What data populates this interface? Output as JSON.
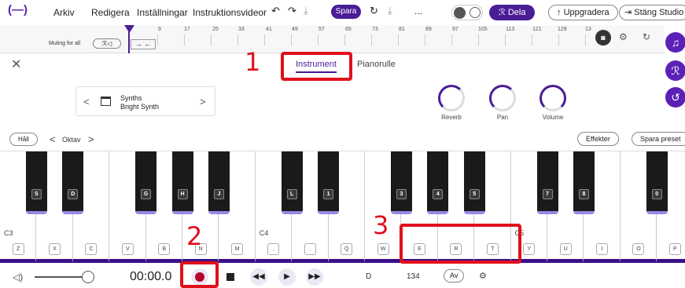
{
  "topbar": {
    "logo": "(—)",
    "menu": [
      "Arkiv",
      "Redigera",
      "Inställningar",
      "Instruktionsvideor"
    ],
    "undo_icon": "↶",
    "redo_icon": "↷",
    "download_icon": "⤓",
    "save_label": "Spara",
    "sync_icon": "↻",
    "upload_icon": "⤓",
    "more": "...",
    "share_label": "Dela",
    "upgrade_label": "Uppgradera",
    "close_studio_label": "Stäng Studio"
  },
  "timeline": {
    "muting_label": "Muting for all",
    "ticks": [
      "9",
      "17",
      "25",
      "33",
      "41",
      "49",
      "57",
      "65",
      "73",
      "81",
      "89",
      "97",
      "105",
      "113",
      "121",
      "129",
      "13"
    ]
  },
  "instrument_panel": {
    "close": "✕",
    "tab_instrument": "Instrument",
    "tab_piano_roll": "Pianorulle",
    "category": "Synths",
    "preset": "Bright Synth",
    "prev": "<",
    "next": ">",
    "knobs": [
      "Reverb",
      "Pan",
      "Volume"
    ],
    "hold_label": "Håll",
    "octave_label": "Oktav",
    "effects_label": "Effekter",
    "save_preset_label": "Spara preset"
  },
  "keyboard": {
    "octave_labels": [
      "C3",
      "C4",
      "C5"
    ],
    "white_keys": [
      "Z",
      "X",
      "C",
      "V",
      "B",
      "N",
      "M",
      ",",
      ".",
      "Q",
      "W",
      "E",
      "R",
      "T",
      "Y",
      "U",
      "I",
      "O",
      "P"
    ],
    "black_keys": [
      "S",
      "D",
      "G",
      "H",
      "J",
      "L",
      "1",
      "3",
      "4",
      "5",
      "7",
      "8",
      "0"
    ]
  },
  "transport": {
    "time": "00:00.0",
    "key": "D",
    "tempo": "134",
    "metronome": "Av"
  },
  "annotations": [
    "1",
    "2",
    "3"
  ],
  "colors": {
    "brand": "#4a1d96",
    "annotation": "#e0101b"
  }
}
